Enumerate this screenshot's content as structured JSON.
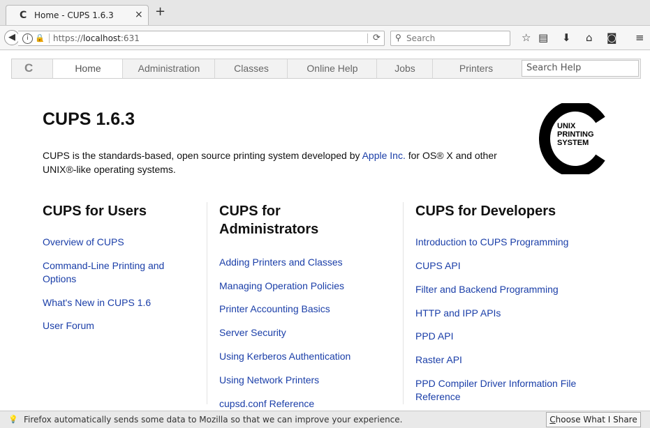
{
  "browser": {
    "tab_title": "Home - CUPS 1.6.3",
    "tab_close": "×",
    "new_tab": "+",
    "url_prefix": "https://",
    "url_host": "localhost",
    "url_port": ":631",
    "search_placeholder": "Search"
  },
  "cups_nav": {
    "tabs": [
      "Home",
      "Administration",
      "Classes",
      "Online Help",
      "Jobs",
      "Printers"
    ],
    "active": "Home",
    "search_placeholder": "Search Help"
  },
  "main": {
    "title": "CUPS 1.6.3",
    "intro_before": "CUPS is the standards-based, open source printing system developed by ",
    "intro_link": "Apple Inc.",
    "intro_after": " for OS® X and other UNIX®-like operating systems.",
    "logo_lines": [
      "UNIX",
      "PRINTING",
      "SYSTEM"
    ]
  },
  "columns": [
    {
      "title": "CUPS for Users",
      "links": [
        "Overview of CUPS",
        "Command-Line Printing and Options",
        "What's New in CUPS 1.6",
        "User Forum"
      ]
    },
    {
      "title": "CUPS for Administrators",
      "links": [
        "Adding Printers and Classes",
        "Managing Operation Policies",
        "Printer Accounting Basics",
        "Server Security",
        "Using Kerberos Authentication",
        "Using Network Printers",
        "cupsd.conf Reference"
      ]
    },
    {
      "title": "CUPS for Developers",
      "links": [
        "Introduction to CUPS Programming",
        "CUPS API",
        "Filter and Backend Programming",
        "HTTP and IPP APIs",
        "PPD API",
        "Raster API",
        "PPD Compiler Driver Information File Reference"
      ]
    }
  ],
  "notification": {
    "text": "Firefox automatically sends some data to Mozilla so that we can improve your experience.",
    "button_key": "C",
    "button_rest": "hoose What I Share"
  },
  "colors": {
    "link": "#1a3ea8",
    "notification_bg": "#e9e9e9"
  }
}
